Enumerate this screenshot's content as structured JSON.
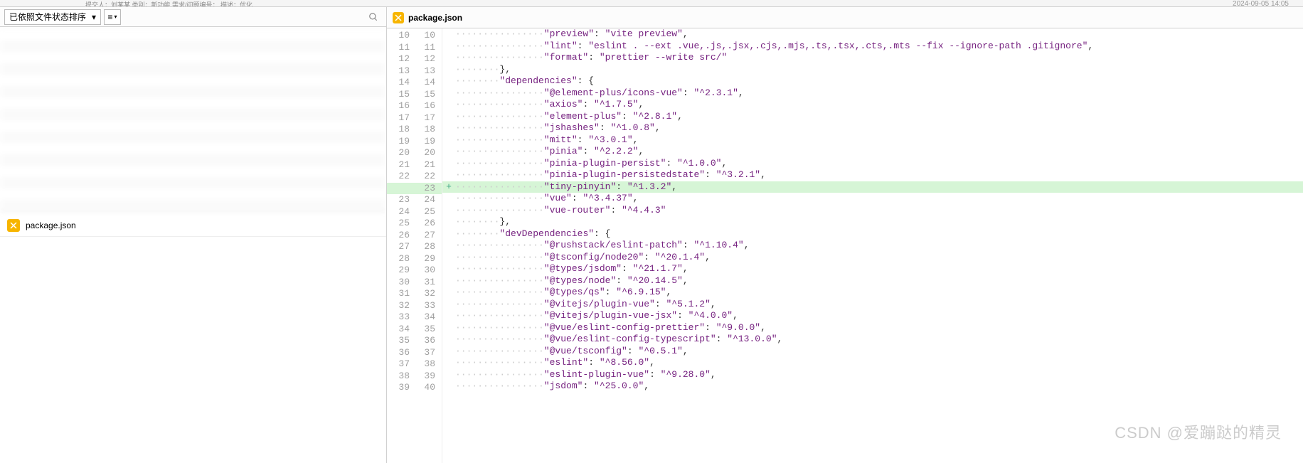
{
  "top_cut_text": "提交人：刘某某  类别：新功能 需求/问题编号：  描述：优化...",
  "timestamp": "2024-09-05 14:05",
  "left": {
    "sort_dropdown": "已依照文件状态排序",
    "file_name": "package.json"
  },
  "right": {
    "tab_name": "package.json"
  },
  "code": {
    "lines": [
      {
        "old": "10",
        "new": "10",
        "added": false,
        "segs": [
          {
            "t": "dots",
            "v": "················"
          },
          {
            "t": "key",
            "v": "\"preview\""
          },
          {
            "t": "punct",
            "v": ": "
          },
          {
            "t": "key",
            "v": "\"vite preview\""
          },
          {
            "t": "punct",
            "v": ","
          }
        ]
      },
      {
        "old": "11",
        "new": "11",
        "added": false,
        "segs": [
          {
            "t": "dots",
            "v": "················"
          },
          {
            "t": "key",
            "v": "\"lint\""
          },
          {
            "t": "punct",
            "v": ": "
          },
          {
            "t": "key",
            "v": "\"eslint . --ext .vue,.js,.jsx,.cjs,.mjs,.ts,.tsx,.cts,.mts --fix --ignore-path .gitignore\""
          },
          {
            "t": "punct",
            "v": ","
          }
        ]
      },
      {
        "old": "12",
        "new": "12",
        "added": false,
        "segs": [
          {
            "t": "dots",
            "v": "················"
          },
          {
            "t": "key",
            "v": "\"format\""
          },
          {
            "t": "punct",
            "v": ": "
          },
          {
            "t": "key",
            "v": "\"prettier --write src/\""
          }
        ]
      },
      {
        "old": "13",
        "new": "13",
        "added": false,
        "segs": [
          {
            "t": "dots",
            "v": "········"
          },
          {
            "t": "brace",
            "v": "},"
          }
        ]
      },
      {
        "old": "14",
        "new": "14",
        "added": false,
        "segs": [
          {
            "t": "dots",
            "v": "········"
          },
          {
            "t": "key",
            "v": "\"dependencies\""
          },
          {
            "t": "punct",
            "v": ": "
          },
          {
            "t": "brace",
            "v": "{"
          }
        ]
      },
      {
        "old": "15",
        "new": "15",
        "added": false,
        "segs": [
          {
            "t": "dots",
            "v": "················"
          },
          {
            "t": "key",
            "v": "\"@element-plus/icons-vue\""
          },
          {
            "t": "punct",
            "v": ": "
          },
          {
            "t": "key",
            "v": "\"^2.3.1\""
          },
          {
            "t": "punct",
            "v": ","
          }
        ]
      },
      {
        "old": "16",
        "new": "16",
        "added": false,
        "segs": [
          {
            "t": "dots",
            "v": "················"
          },
          {
            "t": "key",
            "v": "\"axios\""
          },
          {
            "t": "punct",
            "v": ": "
          },
          {
            "t": "key",
            "v": "\"^1.7.5\""
          },
          {
            "t": "punct",
            "v": ","
          }
        ]
      },
      {
        "old": "17",
        "new": "17",
        "added": false,
        "segs": [
          {
            "t": "dots",
            "v": "················"
          },
          {
            "t": "key",
            "v": "\"element-plus\""
          },
          {
            "t": "punct",
            "v": ": "
          },
          {
            "t": "key",
            "v": "\"^2.8.1\""
          },
          {
            "t": "punct",
            "v": ","
          }
        ]
      },
      {
        "old": "18",
        "new": "18",
        "added": false,
        "segs": [
          {
            "t": "dots",
            "v": "················"
          },
          {
            "t": "key",
            "v": "\"jshashes\""
          },
          {
            "t": "punct",
            "v": ": "
          },
          {
            "t": "key",
            "v": "\"^1.0.8\""
          },
          {
            "t": "punct",
            "v": ","
          }
        ]
      },
      {
        "old": "19",
        "new": "19",
        "added": false,
        "segs": [
          {
            "t": "dots",
            "v": "················"
          },
          {
            "t": "key",
            "v": "\"mitt\""
          },
          {
            "t": "punct",
            "v": ": "
          },
          {
            "t": "key",
            "v": "\"^3.0.1\""
          },
          {
            "t": "punct",
            "v": ","
          }
        ]
      },
      {
        "old": "20",
        "new": "20",
        "added": false,
        "segs": [
          {
            "t": "dots",
            "v": "················"
          },
          {
            "t": "key",
            "v": "\"pinia\""
          },
          {
            "t": "punct",
            "v": ": "
          },
          {
            "t": "key",
            "v": "\"^2.2.2\""
          },
          {
            "t": "punct",
            "v": ","
          }
        ]
      },
      {
        "old": "21",
        "new": "21",
        "added": false,
        "segs": [
          {
            "t": "dots",
            "v": "················"
          },
          {
            "t": "key",
            "v": "\"pinia-plugin-persist\""
          },
          {
            "t": "punct",
            "v": ": "
          },
          {
            "t": "key",
            "v": "\"^1.0.0\""
          },
          {
            "t": "punct",
            "v": ","
          }
        ]
      },
      {
        "old": "22",
        "new": "22",
        "added": false,
        "segs": [
          {
            "t": "dots",
            "v": "················"
          },
          {
            "t": "key",
            "v": "\"pinia-plugin-persistedstate\""
          },
          {
            "t": "punct",
            "v": ": "
          },
          {
            "t": "key",
            "v": "\"^3.2.1\""
          },
          {
            "t": "punct",
            "v": ","
          }
        ]
      },
      {
        "old": "",
        "new": "23",
        "added": true,
        "segs": [
          {
            "t": "dots",
            "v": "················"
          },
          {
            "t": "key",
            "v": "\"tiny-pinyin\""
          },
          {
            "t": "punct",
            "v": ": "
          },
          {
            "t": "key",
            "v": "\"^1.3.2\""
          },
          {
            "t": "punct",
            "v": ","
          }
        ]
      },
      {
        "old": "23",
        "new": "24",
        "added": false,
        "segs": [
          {
            "t": "dots",
            "v": "················"
          },
          {
            "t": "key",
            "v": "\"vue\""
          },
          {
            "t": "punct",
            "v": ": "
          },
          {
            "t": "key",
            "v": "\"^3.4.37\""
          },
          {
            "t": "punct",
            "v": ","
          }
        ]
      },
      {
        "old": "24",
        "new": "25",
        "added": false,
        "segs": [
          {
            "t": "dots",
            "v": "················"
          },
          {
            "t": "key",
            "v": "\"vue-router\""
          },
          {
            "t": "punct",
            "v": ": "
          },
          {
            "t": "key",
            "v": "\"^4.4.3\""
          }
        ]
      },
      {
        "old": "25",
        "new": "26",
        "added": false,
        "segs": [
          {
            "t": "dots",
            "v": "········"
          },
          {
            "t": "brace",
            "v": "},"
          }
        ]
      },
      {
        "old": "26",
        "new": "27",
        "added": false,
        "segs": [
          {
            "t": "dots",
            "v": "········"
          },
          {
            "t": "key",
            "v": "\"devDependencies\""
          },
          {
            "t": "punct",
            "v": ": "
          },
          {
            "t": "brace",
            "v": "{"
          }
        ]
      },
      {
        "old": "27",
        "new": "28",
        "added": false,
        "segs": [
          {
            "t": "dots",
            "v": "················"
          },
          {
            "t": "key",
            "v": "\"@rushstack/eslint-patch\""
          },
          {
            "t": "punct",
            "v": ": "
          },
          {
            "t": "key",
            "v": "\"^1.10.4\""
          },
          {
            "t": "punct",
            "v": ","
          }
        ]
      },
      {
        "old": "28",
        "new": "29",
        "added": false,
        "segs": [
          {
            "t": "dots",
            "v": "················"
          },
          {
            "t": "key",
            "v": "\"@tsconfig/node20\""
          },
          {
            "t": "punct",
            "v": ": "
          },
          {
            "t": "key",
            "v": "\"^20.1.4\""
          },
          {
            "t": "punct",
            "v": ","
          }
        ]
      },
      {
        "old": "29",
        "new": "30",
        "added": false,
        "segs": [
          {
            "t": "dots",
            "v": "················"
          },
          {
            "t": "key",
            "v": "\"@types/jsdom\""
          },
          {
            "t": "punct",
            "v": ": "
          },
          {
            "t": "key",
            "v": "\"^21.1.7\""
          },
          {
            "t": "punct",
            "v": ","
          }
        ]
      },
      {
        "old": "30",
        "new": "31",
        "added": false,
        "segs": [
          {
            "t": "dots",
            "v": "················"
          },
          {
            "t": "key",
            "v": "\"@types/node\""
          },
          {
            "t": "punct",
            "v": ": "
          },
          {
            "t": "key",
            "v": "\"^20.14.5\""
          },
          {
            "t": "punct",
            "v": ","
          }
        ]
      },
      {
        "old": "31",
        "new": "32",
        "added": false,
        "segs": [
          {
            "t": "dots",
            "v": "················"
          },
          {
            "t": "key",
            "v": "\"@types/qs\""
          },
          {
            "t": "punct",
            "v": ": "
          },
          {
            "t": "key",
            "v": "\"^6.9.15\""
          },
          {
            "t": "punct",
            "v": ","
          }
        ]
      },
      {
        "old": "32",
        "new": "33",
        "added": false,
        "segs": [
          {
            "t": "dots",
            "v": "················"
          },
          {
            "t": "key",
            "v": "\"@vitejs/plugin-vue\""
          },
          {
            "t": "punct",
            "v": ": "
          },
          {
            "t": "key",
            "v": "\"^5.1.2\""
          },
          {
            "t": "punct",
            "v": ","
          }
        ]
      },
      {
        "old": "33",
        "new": "34",
        "added": false,
        "segs": [
          {
            "t": "dots",
            "v": "················"
          },
          {
            "t": "key",
            "v": "\"@vitejs/plugin-vue-jsx\""
          },
          {
            "t": "punct",
            "v": ": "
          },
          {
            "t": "key",
            "v": "\"^4.0.0\""
          },
          {
            "t": "punct",
            "v": ","
          }
        ]
      },
      {
        "old": "34",
        "new": "35",
        "added": false,
        "segs": [
          {
            "t": "dots",
            "v": "················"
          },
          {
            "t": "key",
            "v": "\"@vue/eslint-config-prettier\""
          },
          {
            "t": "punct",
            "v": ": "
          },
          {
            "t": "key",
            "v": "\"^9.0.0\""
          },
          {
            "t": "punct",
            "v": ","
          }
        ]
      },
      {
        "old": "35",
        "new": "36",
        "added": false,
        "segs": [
          {
            "t": "dots",
            "v": "················"
          },
          {
            "t": "key",
            "v": "\"@vue/eslint-config-typescript\""
          },
          {
            "t": "punct",
            "v": ": "
          },
          {
            "t": "key",
            "v": "\"^13.0.0\""
          },
          {
            "t": "punct",
            "v": ","
          }
        ]
      },
      {
        "old": "36",
        "new": "37",
        "added": false,
        "segs": [
          {
            "t": "dots",
            "v": "················"
          },
          {
            "t": "key",
            "v": "\"@vue/tsconfig\""
          },
          {
            "t": "punct",
            "v": ": "
          },
          {
            "t": "key",
            "v": "\"^0.5.1\""
          },
          {
            "t": "punct",
            "v": ","
          }
        ]
      },
      {
        "old": "37",
        "new": "38",
        "added": false,
        "segs": [
          {
            "t": "dots",
            "v": "················"
          },
          {
            "t": "key",
            "v": "\"eslint\""
          },
          {
            "t": "punct",
            "v": ": "
          },
          {
            "t": "key",
            "v": "\"^8.56.0\""
          },
          {
            "t": "punct",
            "v": ","
          }
        ]
      },
      {
        "old": "38",
        "new": "39",
        "added": false,
        "segs": [
          {
            "t": "dots",
            "v": "················"
          },
          {
            "t": "key",
            "v": "\"eslint-plugin-vue\""
          },
          {
            "t": "punct",
            "v": ": "
          },
          {
            "t": "key",
            "v": "\"^9.28.0\""
          },
          {
            "t": "punct",
            "v": ","
          }
        ]
      },
      {
        "old": "39",
        "new": "40",
        "added": false,
        "segs": [
          {
            "t": "dots",
            "v": "················"
          },
          {
            "t": "key",
            "v": "\"jsdom\""
          },
          {
            "t": "punct",
            "v": ": "
          },
          {
            "t": "key",
            "v": "\"^25.0.0\""
          },
          {
            "t": "punct",
            "v": ","
          }
        ]
      }
    ]
  },
  "watermark": "CSDN @爱蹦跶的精灵"
}
